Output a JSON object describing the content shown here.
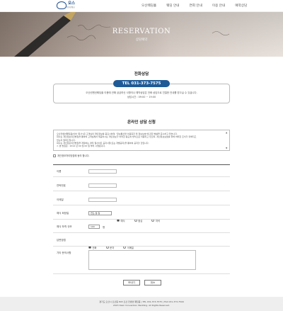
{
  "header": {
    "logo_text": "오스",
    "logo_sub": "컨벤션웨딩",
    "nav": [
      "오산웨딩홀",
      "웨딩 안내",
      "연회 안내",
      "이용 안내",
      "예약상담"
    ]
  },
  "hero": {
    "title": "RESERVATION",
    "subtitle": "상담예약"
  },
  "phone_section": {
    "title": "전화상담",
    "phone": "TEL 031-373-7575",
    "description": "오산컨벤션웨딩홀 이용에 관해 궁금하신 사항이나 예약상담은 전화 상담으로 친절한 안내를 받으실 수 있습니다.",
    "hours": "상담시간 : 09:00 ~ 19:00"
  },
  "online_section": {
    "title": "온라인 상담 신청",
    "policy_lines": [
      "오산컨벤션웨딩홀(이하 '회사')은 고객님의 개인정보를 중요시하며, '정보통신망 이용촉진 및 정보보호'에 관한 법률을 준수하고 있습니다.",
      "회사는 개인정보취급방침을 통하여 고객님께서 제공하시는 개인정보가 어떠한 용도와 방식으로 이용되고 있으며, 개인정보보호를 위해 어떠한 조치가 취해지고",
      "있는지 알려드립니다.",
      "회사는 개인정보취급방침을 개정하는 경우 웹사이트 공지사항(또는 개별공지)을 통하여 공지할 것입니다.",
      "ㅇ 본 방침은 : 2014 년 00 월 00 일 부터 시행됩니다."
    ],
    "agree_label": "개인정보처리방침에 동의 합니다."
  },
  "form": {
    "name_label": "이름",
    "phone_label": "연락번호",
    "email_label": "이메일",
    "date_label": "예식 희망일",
    "date_value": "연도-월-일",
    "time_options": [
      "예식",
      "점심",
      "저녁"
    ],
    "guests_label": "예식 하객 규모",
    "guests_value": "100",
    "guests_unit": "명",
    "event_label": "답변방법",
    "event_options": [
      "전화",
      "문자",
      "이메일"
    ],
    "message_label": "기타 문의사항",
    "submit_label": "보내기",
    "cancel_label": "취소"
  },
  "footer": {
    "line1": "경기도 오산시 오산동 893 오산 컨벤션 웨딩홀 | TEL 031-373-7575 | FAX 031-373-7509",
    "line2": "2015 Osan Convention Wedding. All Rights Reserved."
  }
}
